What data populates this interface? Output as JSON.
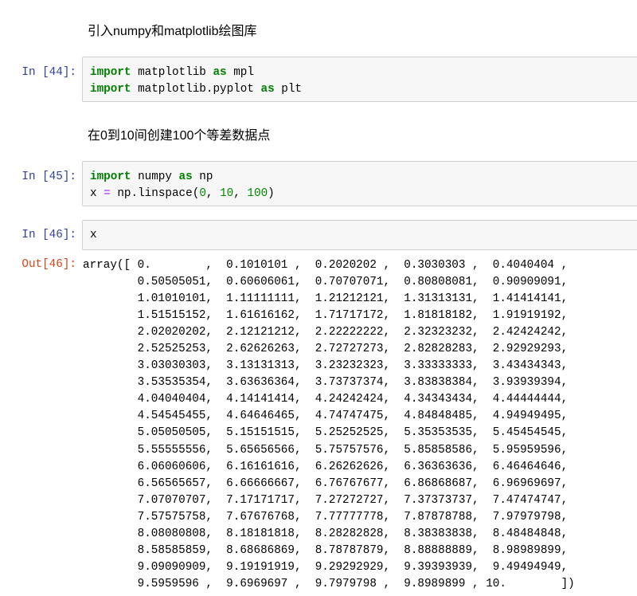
{
  "markdown": [
    "引入numpy和matplotlib绘图库",
    "在0到10间创建100个等差数据点"
  ],
  "cells": [
    {
      "prompt": "In  [44]:",
      "lines": [
        [
          [
            "kw",
            "import"
          ],
          [
            "t",
            " matplotlib "
          ],
          [
            "kw",
            "as"
          ],
          [
            "t",
            " mpl"
          ]
        ],
        [
          [
            "kw",
            "import"
          ],
          [
            "t",
            " matplotlib.pyplot "
          ],
          [
            "kw",
            "as"
          ],
          [
            "t",
            " plt"
          ]
        ]
      ]
    },
    {
      "prompt": "In  [45]:",
      "lines": [
        [
          [
            "kw",
            "import"
          ],
          [
            "t",
            " numpy "
          ],
          [
            "kw",
            "as"
          ],
          [
            "t",
            " np"
          ]
        ],
        [
          [
            "t",
            "x "
          ],
          [
            "op",
            "="
          ],
          [
            "t",
            " np.linspace("
          ],
          [
            "num",
            "0"
          ],
          [
            "t",
            ", "
          ],
          [
            "num",
            "10"
          ],
          [
            "t",
            ", "
          ],
          [
            "num",
            "100"
          ],
          [
            "t",
            ")"
          ]
        ]
      ]
    },
    {
      "prompt": "In  [46]:",
      "lines": [
        [
          [
            "t",
            "x"
          ]
        ]
      ]
    }
  ],
  "output": {
    "prompt": "Out[46]:",
    "lines": [
      "array([ 0.        ,  0.1010101 ,  0.2020202 ,  0.3030303 ,  0.4040404 ,",
      "        0.50505051,  0.60606061,  0.70707071,  0.80808081,  0.90909091,",
      "        1.01010101,  1.11111111,  1.21212121,  1.31313131,  1.41414141,",
      "        1.51515152,  1.61616162,  1.71717172,  1.81818182,  1.91919192,",
      "        2.02020202,  2.12121212,  2.22222222,  2.32323232,  2.42424242,",
      "        2.52525253,  2.62626263,  2.72727273,  2.82828283,  2.92929293,",
      "        3.03030303,  3.13131313,  3.23232323,  3.33333333,  3.43434343,",
      "        3.53535354,  3.63636364,  3.73737374,  3.83838384,  3.93939394,",
      "        4.04040404,  4.14141414,  4.24242424,  4.34343434,  4.44444444,",
      "        4.54545455,  4.64646465,  4.74747475,  4.84848485,  4.94949495,",
      "        5.05050505,  5.15151515,  5.25252525,  5.35353535,  5.45454545,",
      "        5.55555556,  5.65656566,  5.75757576,  5.85858586,  5.95959596,",
      "        6.06060606,  6.16161616,  6.26262626,  6.36363636,  6.46464646,",
      "        6.56565657,  6.66666667,  6.76767677,  6.86868687,  6.96969697,",
      "        7.07070707,  7.17171717,  7.27272727,  7.37373737,  7.47474747,",
      "        7.57575758,  7.67676768,  7.77777778,  7.87878788,  7.97979798,",
      "        8.08080808,  8.18181818,  8.28282828,  8.38383838,  8.48484848,",
      "        8.58585859,  8.68686869,  8.78787879,  8.88888889,  8.98989899,",
      "        9.09090909,  9.19191919,  9.29292929,  9.39393939,  9.49494949,",
      "        9.5959596 ,  9.6969697 ,  9.7979798 ,  9.8989899 , 10.        ])"
    ]
  }
}
